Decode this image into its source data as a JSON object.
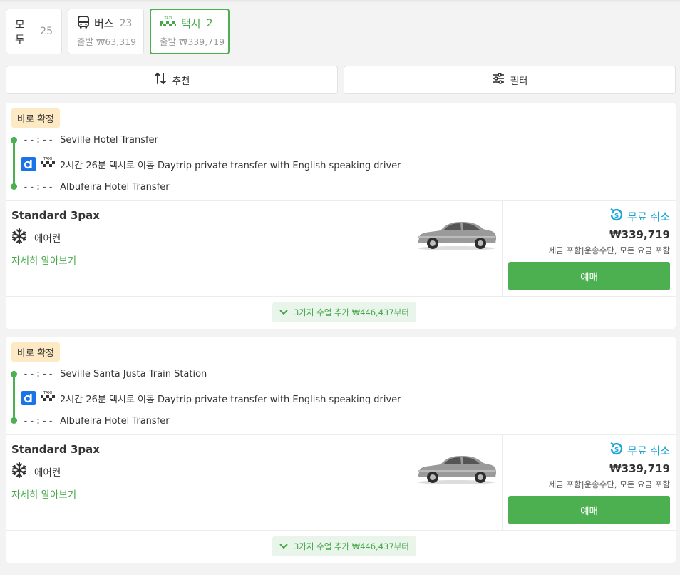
{
  "tabs": [
    {
      "title": "모두",
      "count": "25",
      "sub": ""
    },
    {
      "title": "버스",
      "count": "23",
      "sub": "출발 ₩63,319"
    },
    {
      "title": "택시",
      "count": "2",
      "sub": "출발 ₩339,719"
    }
  ],
  "toolbar": {
    "sort_label": "추천",
    "filter_label": "필터"
  },
  "results": [
    {
      "badge": "바로 확정",
      "origin_time": "--:--",
      "origin": "Seville Hotel Transfer",
      "leg": "2시간 26분 택시로 이동 Daytrip private transfer with English speaking driver",
      "dest_time": "--:--",
      "dest": "Albufeira Hotel Transfer",
      "vehicle": "Standard 3pax",
      "amenity": "에어컨",
      "details": "자세히 알아보기",
      "cancel": "무료 취소",
      "price": "₩339,719",
      "price_note": "세금 포함|운송수단, 모든 요금 포함",
      "book": "예매",
      "more": "3가지 수업 추가 ₩446,437부터"
    },
    {
      "badge": "바로 확정",
      "origin_time": "--:--",
      "origin": "Seville Santa Justa Train Station",
      "leg": "2시간 26분 택시로 이동 Daytrip private transfer with English speaking driver",
      "dest_time": "--:--",
      "dest": "Albufeira Hotel Transfer",
      "vehicle": "Standard 3pax",
      "amenity": "에어컨",
      "details": "자세히 알아보기",
      "cancel": "무료 취소",
      "price": "₩339,719",
      "price_note": "세금 포함|운송수단, 모든 요금 포함",
      "book": "예매",
      "more": "3가지 수업 추가 ₩446,437부터"
    }
  ],
  "colors": {
    "accent": "#4caf50",
    "cancel": "#1ba6d6",
    "badge_bg": "#fde9c3"
  },
  "icons": [
    "bus-icon",
    "taxi-icon",
    "sort-icon",
    "filter-icon",
    "daytrip-logo-icon",
    "snowflake-icon",
    "free-cancel-icon",
    "chevron-down-icon",
    "car-image"
  ]
}
